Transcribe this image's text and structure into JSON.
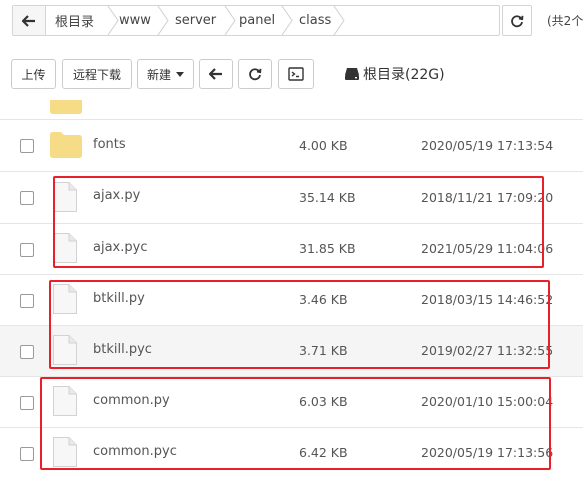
{
  "breadcrumb": {
    "segments": [
      "根目录",
      "www",
      "server",
      "panel",
      "class"
    ],
    "total_text": "(共2个"
  },
  "toolbar": {
    "upload_label": "上传",
    "remote_download_label": "远程下载",
    "new_label": "新建",
    "disk_label": "根目录(22G)"
  },
  "files": [
    {
      "name": "fonts",
      "size": "4.00 KB",
      "date": "2020/05/19 17:13:54",
      "type": "folder"
    },
    {
      "name": "ajax.py",
      "size": "35.14 KB",
      "date": "2018/11/21 17:09:20",
      "type": "file"
    },
    {
      "name": "ajax.pyc",
      "size": "31.85 KB",
      "date": "2021/05/29 11:04:06",
      "type": "file"
    },
    {
      "name": "btkill.py",
      "size": "3.46 KB",
      "date": "2018/03/15 14:46:52",
      "type": "file"
    },
    {
      "name": "btkill.pyc",
      "size": "3.71 KB",
      "date": "2019/02/27 11:32:55",
      "type": "file"
    },
    {
      "name": "common.py",
      "size": "6.03 KB",
      "date": "2020/01/10 15:00:04",
      "type": "file"
    },
    {
      "name": "common.pyc",
      "size": "6.42 KB",
      "date": "2020/05/19 17:13:56",
      "type": "file"
    }
  ],
  "colors": {
    "highlight": "#e8202a",
    "folder": "#f6dc86",
    "row_alt": "#f5f5f5"
  }
}
